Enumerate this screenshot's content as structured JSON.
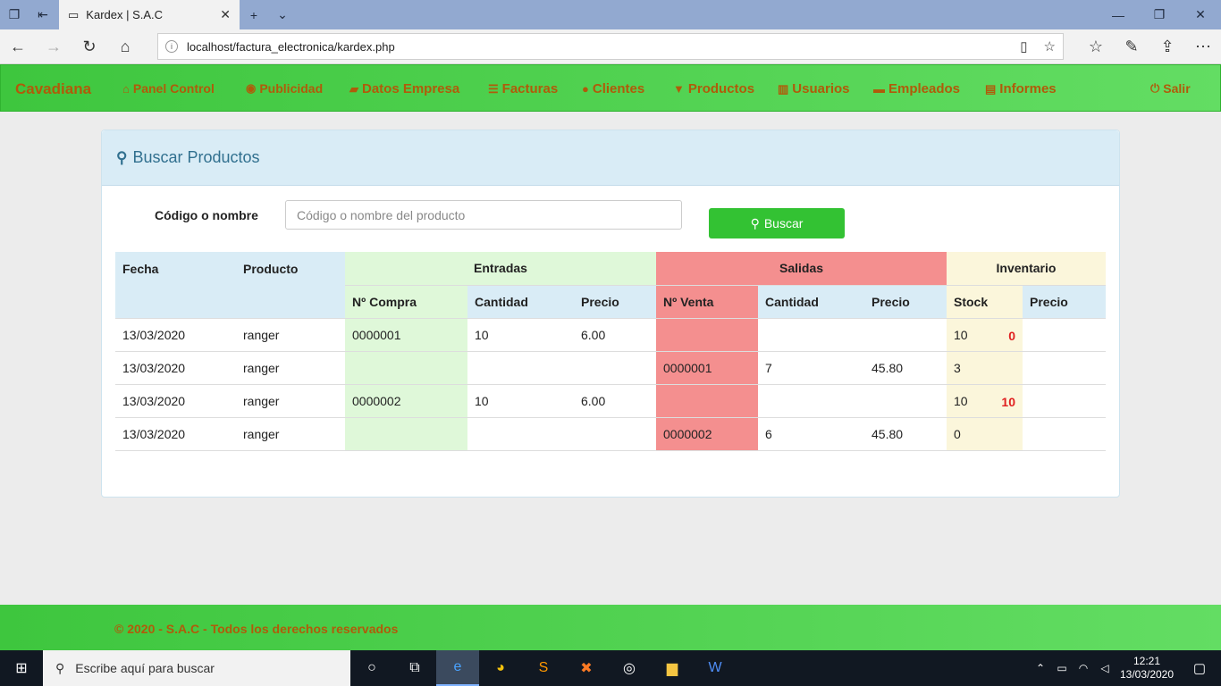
{
  "browser": {
    "tab_title": "Kardex | S.A.C",
    "url": "localhost/factura_electronica/kardex.php"
  },
  "navbar": {
    "brand": "Cavadiana",
    "items": [
      {
        "label": "Panel Control",
        "icon": "home-icon"
      },
      {
        "label": "Publicidad",
        "icon": "eye-icon"
      },
      {
        "label": "Datos Empresa",
        "icon": "folder-open-icon"
      },
      {
        "label": "Facturas",
        "icon": "list-icon"
      },
      {
        "label": "Clientes",
        "icon": "user-icon"
      },
      {
        "label": "Productos",
        "icon": "cart-icon"
      },
      {
        "label": "Usuarios",
        "icon": "barcode-icon"
      },
      {
        "label": "Empleados",
        "icon": "briefcase-icon"
      },
      {
        "label": "Informes",
        "icon": "report-icon"
      }
    ],
    "logout": "Salir"
  },
  "panel": {
    "title": "Buscar Productos",
    "search_label": "Código o nombre",
    "search_placeholder": "Código o nombre del producto",
    "search_value": "",
    "search_button": "Buscar"
  },
  "table": {
    "groups": {
      "fecha": "Fecha",
      "producto": "Producto",
      "entradas": "Entradas",
      "salidas": "Salidas",
      "inventario": "Inventario"
    },
    "subheaders": {
      "n_compra": "Nº Compra",
      "e_cantidad": "Cantidad",
      "e_precio": "Precio",
      "n_venta": "Nº Venta",
      "s_cantidad": "Cantidad",
      "s_precio": "Precio",
      "stock": "Stock",
      "i_precio": "Precio"
    },
    "rows": [
      {
        "fecha": "13/03/2020",
        "producto": "ranger",
        "n_compra": "0000001",
        "e_cantidad": "10",
        "e_precio": "6.00",
        "n_venta": "",
        "s_cantidad": "",
        "s_precio": "",
        "stock": "10",
        "stock_prev": "0",
        "i_precio": ""
      },
      {
        "fecha": "13/03/2020",
        "producto": "ranger",
        "n_compra": "",
        "e_cantidad": "",
        "e_precio": "",
        "n_venta": "0000001",
        "s_cantidad": "7",
        "s_precio": "45.80",
        "stock": "3",
        "stock_prev": "",
        "i_precio": ""
      },
      {
        "fecha": "13/03/2020",
        "producto": "ranger",
        "n_compra": "0000002",
        "e_cantidad": "10",
        "e_precio": "6.00",
        "n_venta": "",
        "s_cantidad": "",
        "s_precio": "",
        "stock": "10",
        "stock_prev": "10",
        "i_precio": ""
      },
      {
        "fecha": "13/03/2020",
        "producto": "ranger",
        "n_compra": "",
        "e_cantidad": "",
        "e_precio": "",
        "n_venta": "0000002",
        "s_cantidad": "6",
        "s_precio": "45.80",
        "stock": "0",
        "stock_prev": "",
        "i_precio": ""
      }
    ]
  },
  "footer": {
    "text": "© 2020 - S.A.C - Todos los derechos reservados"
  },
  "taskbar": {
    "search_placeholder": "Escribe aquí para buscar",
    "time": "12:21",
    "date": "13/03/2020"
  },
  "colors": {
    "navbar_green": "#3ec63e",
    "brand_orange": "#b05b0a",
    "entradas_green": "#dff8d9",
    "salidas_red": "#f48f8f",
    "inventario_yellow": "#fbf6db",
    "header_blue": "#d9ecf6",
    "alert_red": "#e02020"
  }
}
